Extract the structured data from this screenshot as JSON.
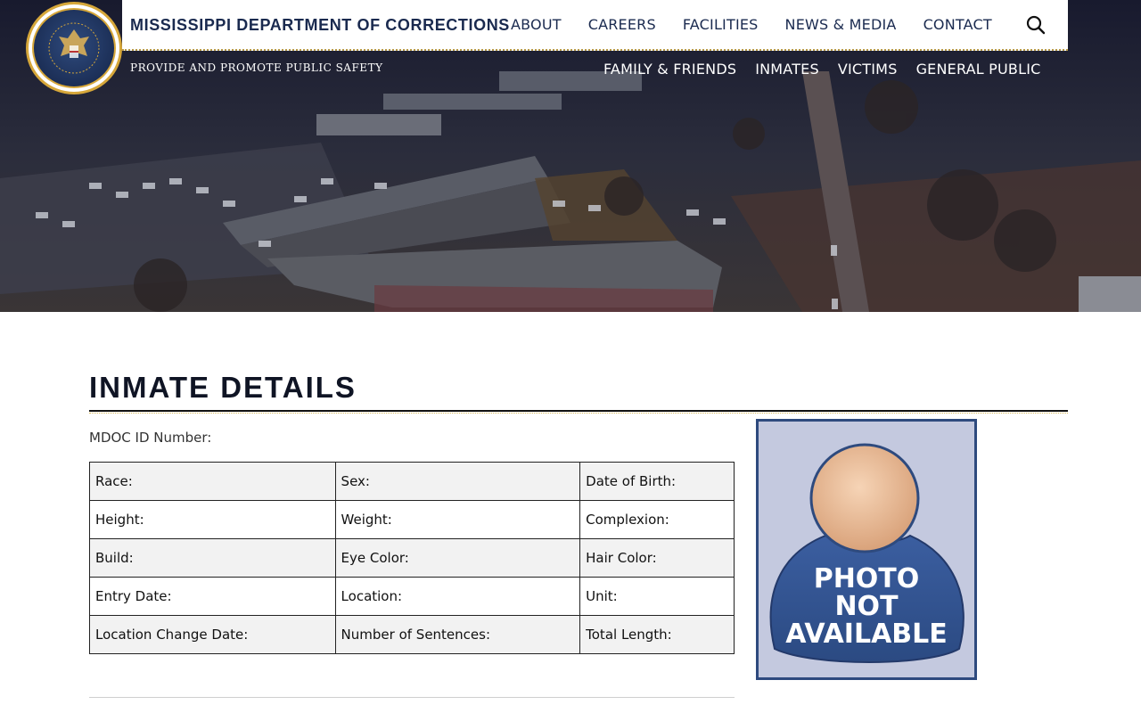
{
  "header": {
    "brand": "MISSISSIPPI DEPARTMENT OF CORRECTIONS",
    "tagline": "PROVIDE AND PROMOTE PUBLIC SAFETY",
    "seal_text": "MISSISSIPPI DEPARTMENT OF CORRECTIONS",
    "top_nav": [
      "ABOUT",
      "CAREERS",
      "FACILITIES",
      "NEWS & MEDIA",
      "CONTACT"
    ],
    "sub_nav": [
      "FAMILY & FRIENDS",
      "INMATES",
      "VICTIMS",
      "GENERAL PUBLIC"
    ],
    "search_icon": "search-icon"
  },
  "main": {
    "title": "INMATE DETAILS",
    "mdoc_id_label": "MDOC ID Number:",
    "details_rows": [
      [
        "Race:",
        "Sex:",
        "Date of Birth:"
      ],
      [
        "Height:",
        "Weight:",
        "Complexion:"
      ],
      [
        "Build:",
        "Eye Color:",
        "Hair Color:"
      ],
      [
        "Entry Date:",
        "Location:",
        "Unit:"
      ],
      [
        "Location Change Date:",
        "Number of Sentences:",
        "Total Length:"
      ]
    ],
    "photo": {
      "lines": [
        "PHOTO",
        "NOT",
        "AVAILABLE"
      ],
      "icon": "person-placeholder-icon"
    }
  },
  "colors": {
    "navy": "#1a2a4f",
    "gold": "#d6a73a",
    "photo_bg": "#c4c9df",
    "photo_border": "#2e4a7e"
  }
}
